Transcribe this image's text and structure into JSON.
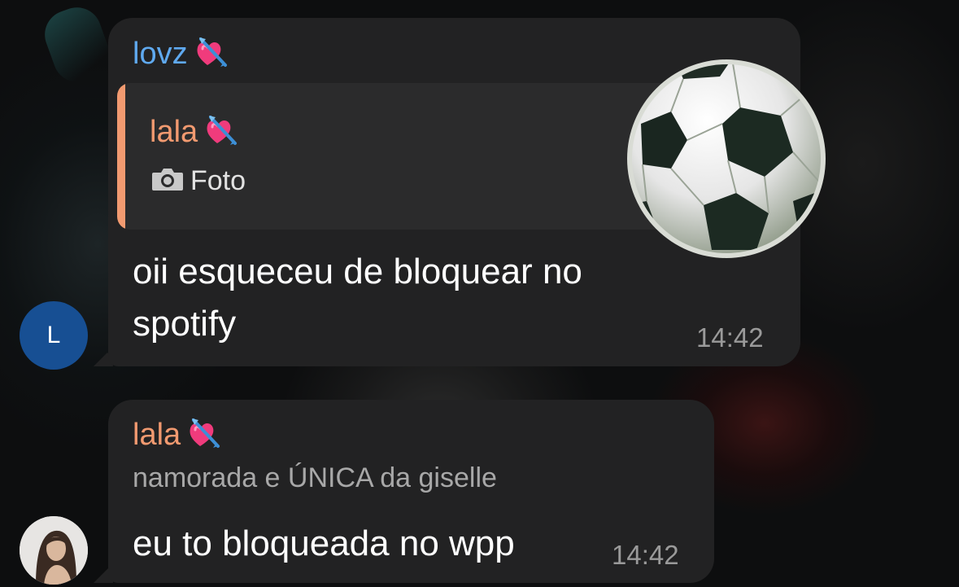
{
  "messages": [
    {
      "sender": "lovz",
      "sender_color": "#5fa9ef",
      "sender_emoji": "heart-with-arrow",
      "avatar_letter": "L",
      "avatar_color": "#174f93",
      "reply": {
        "name": "lala",
        "name_color": "#f29a70",
        "emoji": "heart-with-arrow",
        "icon": "camera-icon",
        "label": "Foto",
        "thumbnail": "soccer-ball-sticker"
      },
      "text": "oii esqueceu de bloquear no spotify",
      "time": "14:42"
    },
    {
      "sender": "lala",
      "sender_color": "#f29a70",
      "sender_emoji": "heart-with-arrow",
      "subtitle": "namorada e ÚNICA da giselle",
      "avatar": "profile-photo",
      "text": "eu to bloqueada no wpp",
      "time": "14:42"
    }
  ]
}
